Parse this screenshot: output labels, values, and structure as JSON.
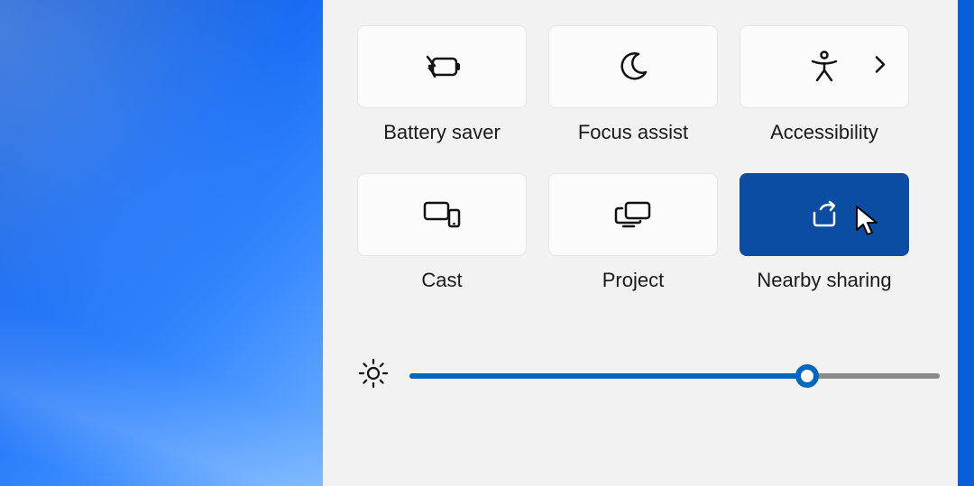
{
  "tiles": {
    "battery_saver": {
      "label": "Battery saver",
      "active": false
    },
    "focus_assist": {
      "label": "Focus assist",
      "active": false
    },
    "accessibility": {
      "label": "Accessibility",
      "active": false,
      "has_expand": true
    },
    "cast": {
      "label": "Cast",
      "active": false
    },
    "project": {
      "label": "Project",
      "active": false
    },
    "nearby_sharing": {
      "label": "Nearby sharing",
      "active": true
    }
  },
  "brightness": {
    "value_percent": 75
  },
  "colors": {
    "accent": "#0067c0",
    "tile_active": "#0a4da2",
    "panel_bg": "#f2f2f2"
  }
}
